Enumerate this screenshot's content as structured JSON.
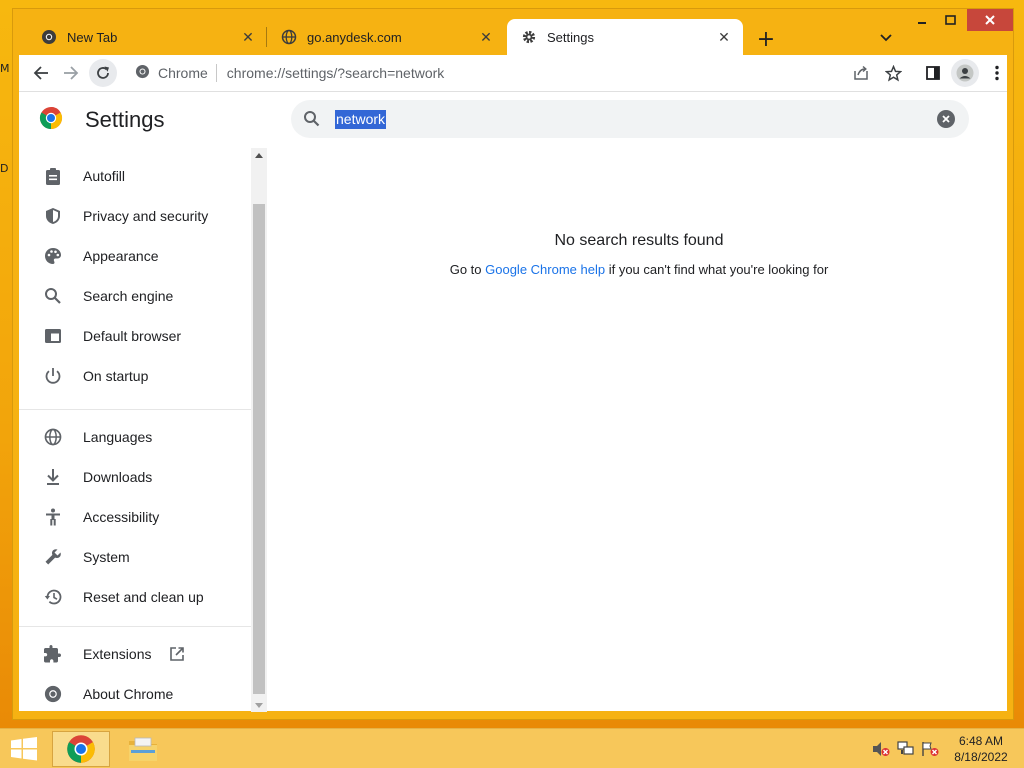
{
  "desktop": {
    "edge_labels": [
      "M",
      "D"
    ]
  },
  "tabs": [
    {
      "label": "New Tab",
      "icon": "chrome-icon",
      "active": false
    },
    {
      "label": "go.anydesk.com",
      "icon": "globe-icon",
      "active": false
    },
    {
      "label": "Settings",
      "icon": "gear-icon",
      "active": true
    }
  ],
  "toolbar": {
    "site_chip": "Chrome",
    "url": "chrome://settings/?search=network"
  },
  "settings": {
    "title": "Settings",
    "search_value": "network",
    "nav_group1": [
      {
        "label": "Autofill",
        "icon": "clipboard-icon"
      },
      {
        "label": "Privacy and security",
        "icon": "shield-icon"
      },
      {
        "label": "Appearance",
        "icon": "palette-icon"
      },
      {
        "label": "Search engine",
        "icon": "search-icon"
      },
      {
        "label": "Default browser",
        "icon": "browser-window-icon"
      },
      {
        "label": "On startup",
        "icon": "power-icon"
      }
    ],
    "nav_group2": [
      {
        "label": "Languages",
        "icon": "globe-icon"
      },
      {
        "label": "Downloads",
        "icon": "download-icon"
      },
      {
        "label": "Accessibility",
        "icon": "accessibility-icon"
      },
      {
        "label": "System",
        "icon": "wrench-icon"
      },
      {
        "label": "Reset and clean up",
        "icon": "history-icon"
      }
    ],
    "nav_group3": [
      {
        "label": "Extensions",
        "icon": "puzzle-icon"
      },
      {
        "label": "About Chrome",
        "icon": "chrome-icon"
      }
    ],
    "no_results": {
      "title": "No search results found",
      "help_prefix": "Go to ",
      "help_link": "Google Chrome help",
      "help_suffix": " if you can't find what you're looking for"
    }
  },
  "taskbar": {
    "time": "6:48 AM",
    "date": "8/18/2022"
  },
  "colors": {
    "accent": "#1a73e8",
    "selection": "#3367d6",
    "window_frame": "#f6b212",
    "close_button": "#c7473b"
  }
}
